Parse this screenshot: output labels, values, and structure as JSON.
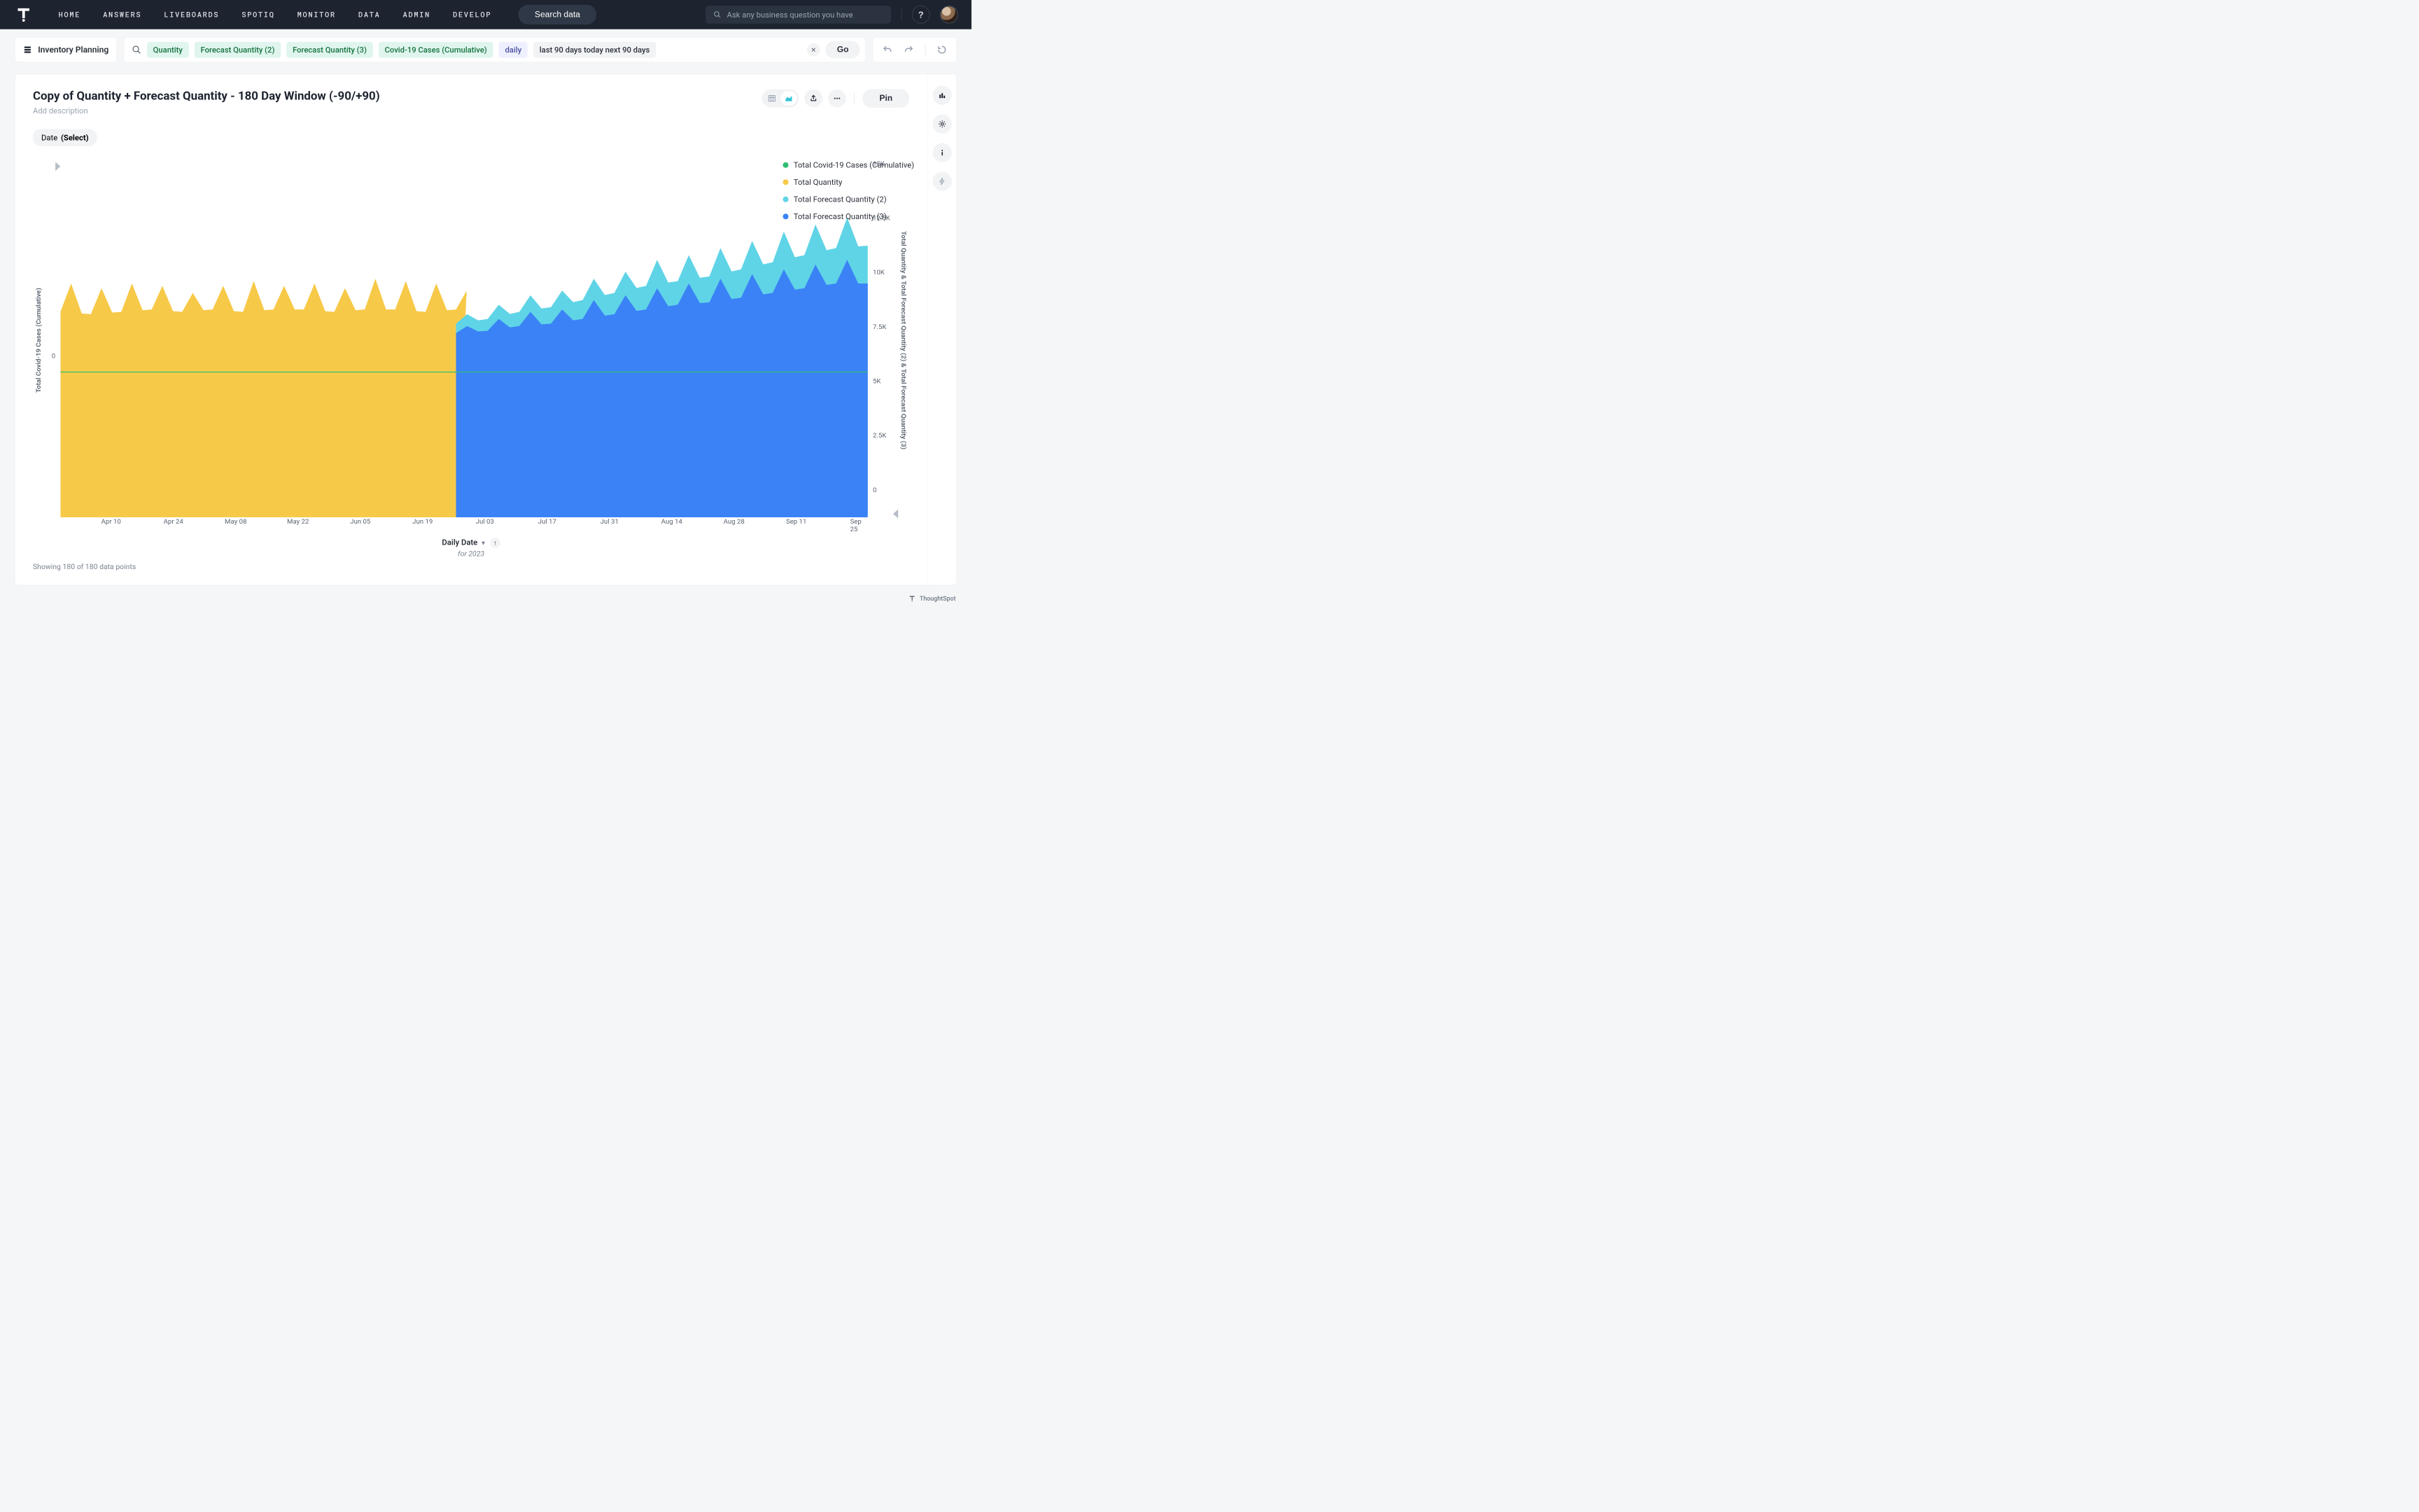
{
  "header": {
    "nav": [
      "HOME",
      "ANSWERS",
      "LIVEBOARDS",
      "SPOTIQ",
      "MONITOR",
      "DATA",
      "ADMIN",
      "DEVELOP"
    ],
    "search_data": "Search data",
    "ask_placeholder": "Ask any business question you have",
    "help": "?"
  },
  "source": {
    "name": "Inventory Planning"
  },
  "query": {
    "pills": [
      {
        "text": "Quantity",
        "kind": "measure"
      },
      {
        "text": "Forecast Quantity (2)",
        "kind": "measure"
      },
      {
        "text": "Forecast Quantity (3)",
        "kind": "measure"
      },
      {
        "text": "Covid-19 Cases (Cumulative)",
        "kind": "measure"
      },
      {
        "text": "daily",
        "kind": "attr"
      },
      {
        "text": "last 90 days today next 90 days",
        "kind": "plain"
      }
    ],
    "go": "Go"
  },
  "card": {
    "title": "Copy of Quantity + Forecast Quantity - 180 Day Window (-90/+90)",
    "add_desc": "Add description",
    "pin": "Pin",
    "filter": {
      "label": "Date",
      "value": "(Select)"
    },
    "footer": "Showing 180 of 180 data points",
    "x_title": "Daily Date",
    "x_sub": "for 2023"
  },
  "legend": {
    "items": [
      {
        "label": "Total Covid-19 Cases (Cumulative)",
        "color": "#2fbf71"
      },
      {
        "label": "Total Quantity",
        "color": "#f7c948"
      },
      {
        "label": "Total Forecast Quantity (2)",
        "color": "#5fd4e6"
      },
      {
        "label": "Total Forecast Quantity (3)",
        "color": "#3b82f6"
      }
    ]
  },
  "axes": {
    "left": {
      "label": "Total Covid-19 Cases (Cumulative)",
      "ticks": [
        {
          "v": "0",
          "pos": 0.59
        }
      ]
    },
    "right": {
      "label": "Total Quantity & Total Forecast Quantity (2) & Total Forecast Quantity (3)",
      "ticks": [
        {
          "v": "15K",
          "pos": 0.0
        },
        {
          "v": "12.5K",
          "pos": 0.166
        },
        {
          "v": "10K",
          "pos": 0.333
        },
        {
          "v": "7.5K",
          "pos": 0.5
        },
        {
          "v": "5K",
          "pos": 0.666
        },
        {
          "v": "2.5K",
          "pos": 0.833
        },
        {
          "v": "0",
          "pos": 1.0
        }
      ]
    },
    "x_ticks": [
      {
        "v": "Apr 10",
        "pos": 0.055
      },
      {
        "v": "Apr 24",
        "pos": 0.132
      },
      {
        "v": "May 08",
        "pos": 0.209
      },
      {
        "v": "May 22",
        "pos": 0.286
      },
      {
        "v": "Jun 05",
        "pos": 0.363
      },
      {
        "v": "Jun 19",
        "pos": 0.44
      },
      {
        "v": "Jul 03",
        "pos": 0.517
      },
      {
        "v": "Jul 17",
        "pos": 0.594
      },
      {
        "v": "Jul 31",
        "pos": 0.671
      },
      {
        "v": "Aug 14",
        "pos": 0.748
      },
      {
        "v": "Aug 28",
        "pos": 0.825
      },
      {
        "v": "Sep 11",
        "pos": 0.902
      },
      {
        "v": "Sep 25",
        "pos": 0.979
      }
    ]
  },
  "chart_data": {
    "type": "area",
    "xlabel": "Daily Date",
    "x_range": [
      "2023-03-30",
      "2023-09-25"
    ],
    "right_y": {
      "label": "Total Quantity & Total Forecast Quantity (2) & Total Forecast Quantity (3)",
      "range": [
        0,
        15000
      ]
    },
    "left_y": {
      "label": "Total Covid-19 Cases (Cumulative)",
      "zero_at": 0.59
    },
    "series": [
      {
        "name": "Total Quantity",
        "axis": "right",
        "color": "#f7c948",
        "x": [
          "Apr 01",
          "Apr 08",
          "Apr 15",
          "Apr 22",
          "Apr 29",
          "May 06",
          "May 13",
          "May 20",
          "May 27",
          "Jun 03",
          "Jun 10",
          "Jun 17",
          "Jun 24",
          "Jun 30"
        ],
        "baseline": [
          8700,
          8600,
          8700,
          8800,
          8700,
          8800,
          8700,
          8800,
          8800,
          8700,
          8800,
          8800,
          8700,
          8800
        ],
        "peak": [
          9900,
          9700,
          9900,
          9800,
          9500,
          9800,
          10000,
          9800,
          9900,
          9700,
          10100,
          10000,
          9900,
          9600
        ]
      },
      {
        "name": "Total Forecast Quantity (3)",
        "axis": "right",
        "color": "#3b82f6",
        "x": [
          "Jun 30",
          "Jul 07",
          "Jul 14",
          "Jul 21",
          "Jul 28",
          "Aug 04",
          "Aug 11",
          "Aug 18",
          "Aug 25",
          "Sep 01",
          "Sep 08",
          "Sep 15",
          "Sep 22",
          "Sep 25"
        ],
        "baseline": [
          7800,
          7900,
          8100,
          8200,
          8400,
          8600,
          8800,
          9000,
          9100,
          9300,
          9500,
          9700,
          9900,
          9900
        ],
        "peak": [
          8100,
          8400,
          8700,
          8800,
          9200,
          9400,
          9700,
          9900,
          10100,
          10300,
          10500,
          10700,
          10900,
          11050
        ]
      },
      {
        "name": "Total Forecast Quantity (2)",
        "axis": "right",
        "color": "#5fd4e6",
        "note": "stacked on top of Forecast Quantity (3)",
        "x": [
          "Jun 30",
          "Jul 07",
          "Jul 14",
          "Jul 21",
          "Jul 28",
          "Aug 04",
          "Aug 11",
          "Aug 18",
          "Aug 25",
          "Sep 01",
          "Sep 08",
          "Sep 15",
          "Sep 22",
          "Sep 25"
        ],
        "top_baseline": [
          8200,
          8400,
          8700,
          8900,
          9200,
          9500,
          9800,
          10000,
          10200,
          10500,
          10800,
          11100,
          11400,
          11500
        ],
        "top_peak": [
          8600,
          9000,
          9400,
          9600,
          10100,
          10400,
          10900,
          11100,
          11400,
          11700,
          12100,
          12400,
          12700,
          12900
        ]
      },
      {
        "name": "Total Covid-19 Cases (Cumulative)",
        "axis": "left",
        "color": "#2fbf71",
        "note": "flat line near left-axis zero across full range",
        "approx_value": "~0 on its own scale"
      }
    ]
  },
  "brand": "ThoughtSpot"
}
